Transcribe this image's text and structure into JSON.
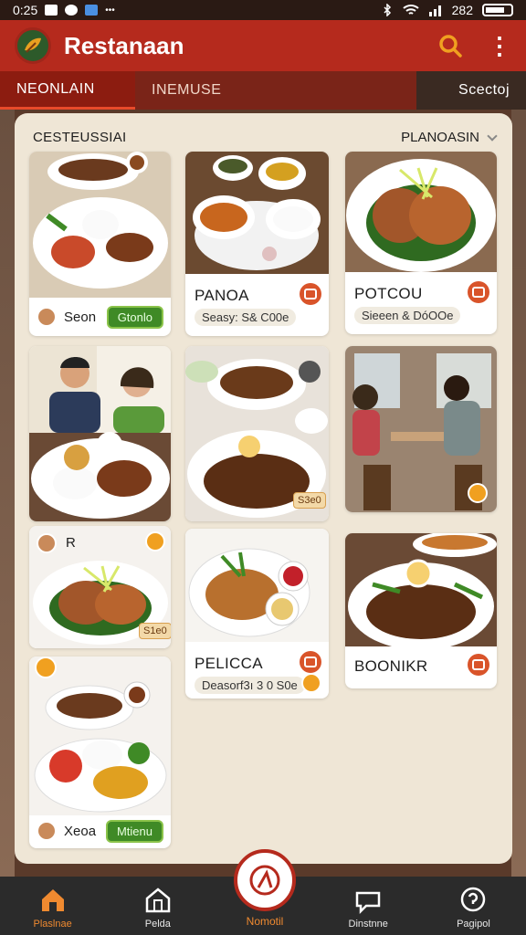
{
  "status": {
    "time": "0:25",
    "battery": "282"
  },
  "appbar": {
    "title": "Restanaan"
  },
  "tabs": [
    {
      "label": "NEONLAIN"
    },
    {
      "label": "INEMUSE"
    },
    {
      "label": "Scectoj"
    }
  ],
  "panel": {
    "heading": "CESTEUSSIAI",
    "filter": "PLANOASIN"
  },
  "cards": {
    "c1": {
      "name": "Seon",
      "button": "Gtonlo"
    },
    "c2": {
      "title": "PANOA",
      "sub": "Seasy: S& C00e"
    },
    "c3": {
      "title": "POTCOU",
      "sub": "Sieeen & DóOOe"
    },
    "c7": {
      "name": "R"
    },
    "c8": {
      "title": "PELICCA",
      "sub": "Deasorf3ı 3 0 S0e"
    },
    "c9": {
      "title": "BOONIKR"
    },
    "c10": {
      "name": "Xeoa",
      "button": "Mtienu"
    },
    "c5": {
      "badge": "S3e0"
    },
    "c7b": {
      "badge": "S1e0"
    }
  },
  "nav": [
    {
      "label": "Plaslnae",
      "icon": "home-icon"
    },
    {
      "label": "Pelda",
      "icon": "building-icon"
    },
    {
      "label": "Nomotil",
      "icon": "plate-icon"
    },
    {
      "label": "Dinstnne",
      "icon": "chat-icon"
    },
    {
      "label": "Pagipol",
      "icon": "help-icon"
    }
  ],
  "colors": {
    "primary": "#b52a1d",
    "accent": "#f08a30",
    "panel": "#efe6d6"
  }
}
